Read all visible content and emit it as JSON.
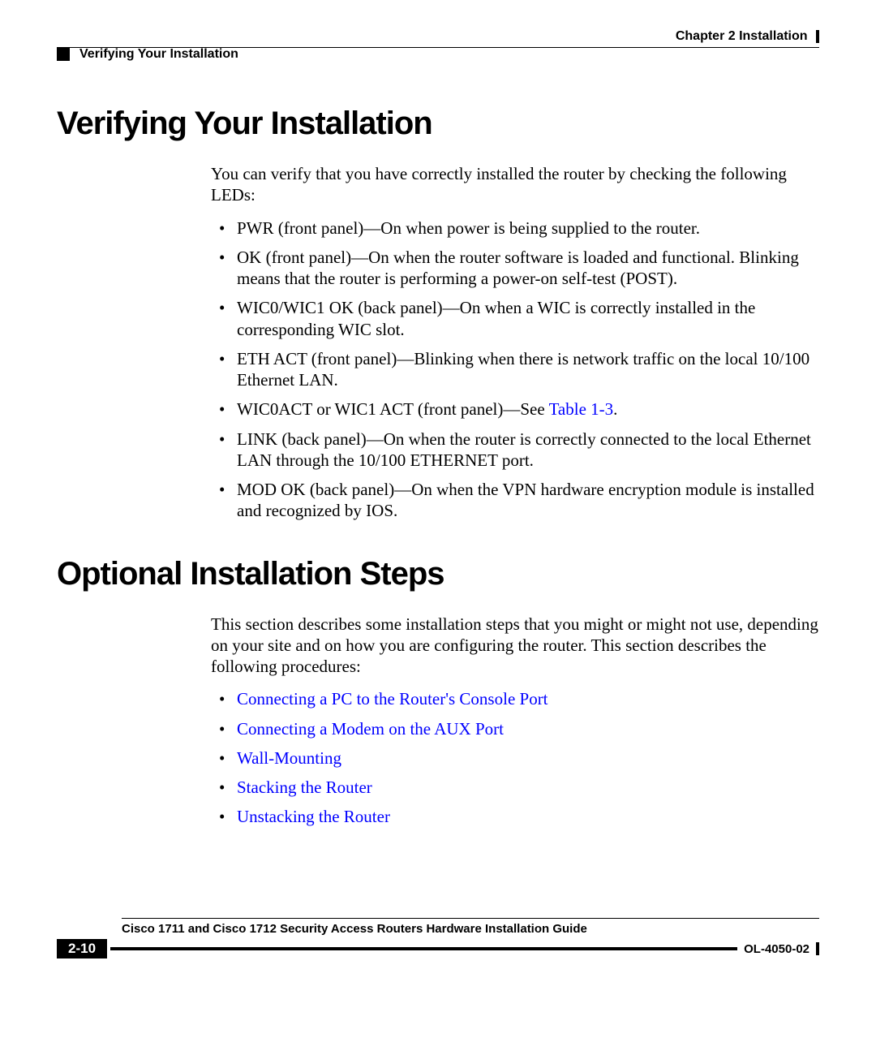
{
  "header": {
    "chapter": "Chapter 2      Installation",
    "section": "Verifying Your Installation"
  },
  "section1": {
    "heading": "Verifying Your Installation",
    "intro": "You can verify that you have correctly installed the router by checking the following LEDs:",
    "items": [
      "PWR (front panel)—On when power is being supplied to the router.",
      "OK (front panel)—On when the router software is loaded and functional. Blinking means that the router is performing a power-on self-test (POST).",
      "WIC0/WIC1 OK (back panel)—On when a WIC is correctly installed in the corresponding WIC slot.",
      "ETH ACT (front panel)—Blinking when there is network traffic on the local 10/100 Ethernet LAN.",
      "",
      "LINK (back panel)—On when the router is correctly connected to the local Ethernet LAN through the 10/100 ETHERNET port.",
      "MOD OK (back panel)—On when the VPN hardware encryption module is installed and recognized by IOS."
    ],
    "item5_prefix": "WIC0ACT or WIC1 ACT (front panel)—See ",
    "item5_link": "Table 1-3",
    "item5_suffix": "."
  },
  "section2": {
    "heading": "Optional Installation Steps",
    "intro": "This section describes some installation steps that you might or might not use, depending on your site and on how you are configuring the router. This section describes the following procedures:",
    "links": [
      "Connecting a PC to the Router's Console Port",
      "Connecting a Modem on the AUX Port",
      "Wall-Mounting",
      "Stacking the Router",
      "Unstacking the Router"
    ]
  },
  "footer": {
    "guide": "Cisco 1711 and Cisco 1712 Security Access Routers Hardware Installation Guide",
    "page": "2-10",
    "doc": "OL-4050-02"
  }
}
